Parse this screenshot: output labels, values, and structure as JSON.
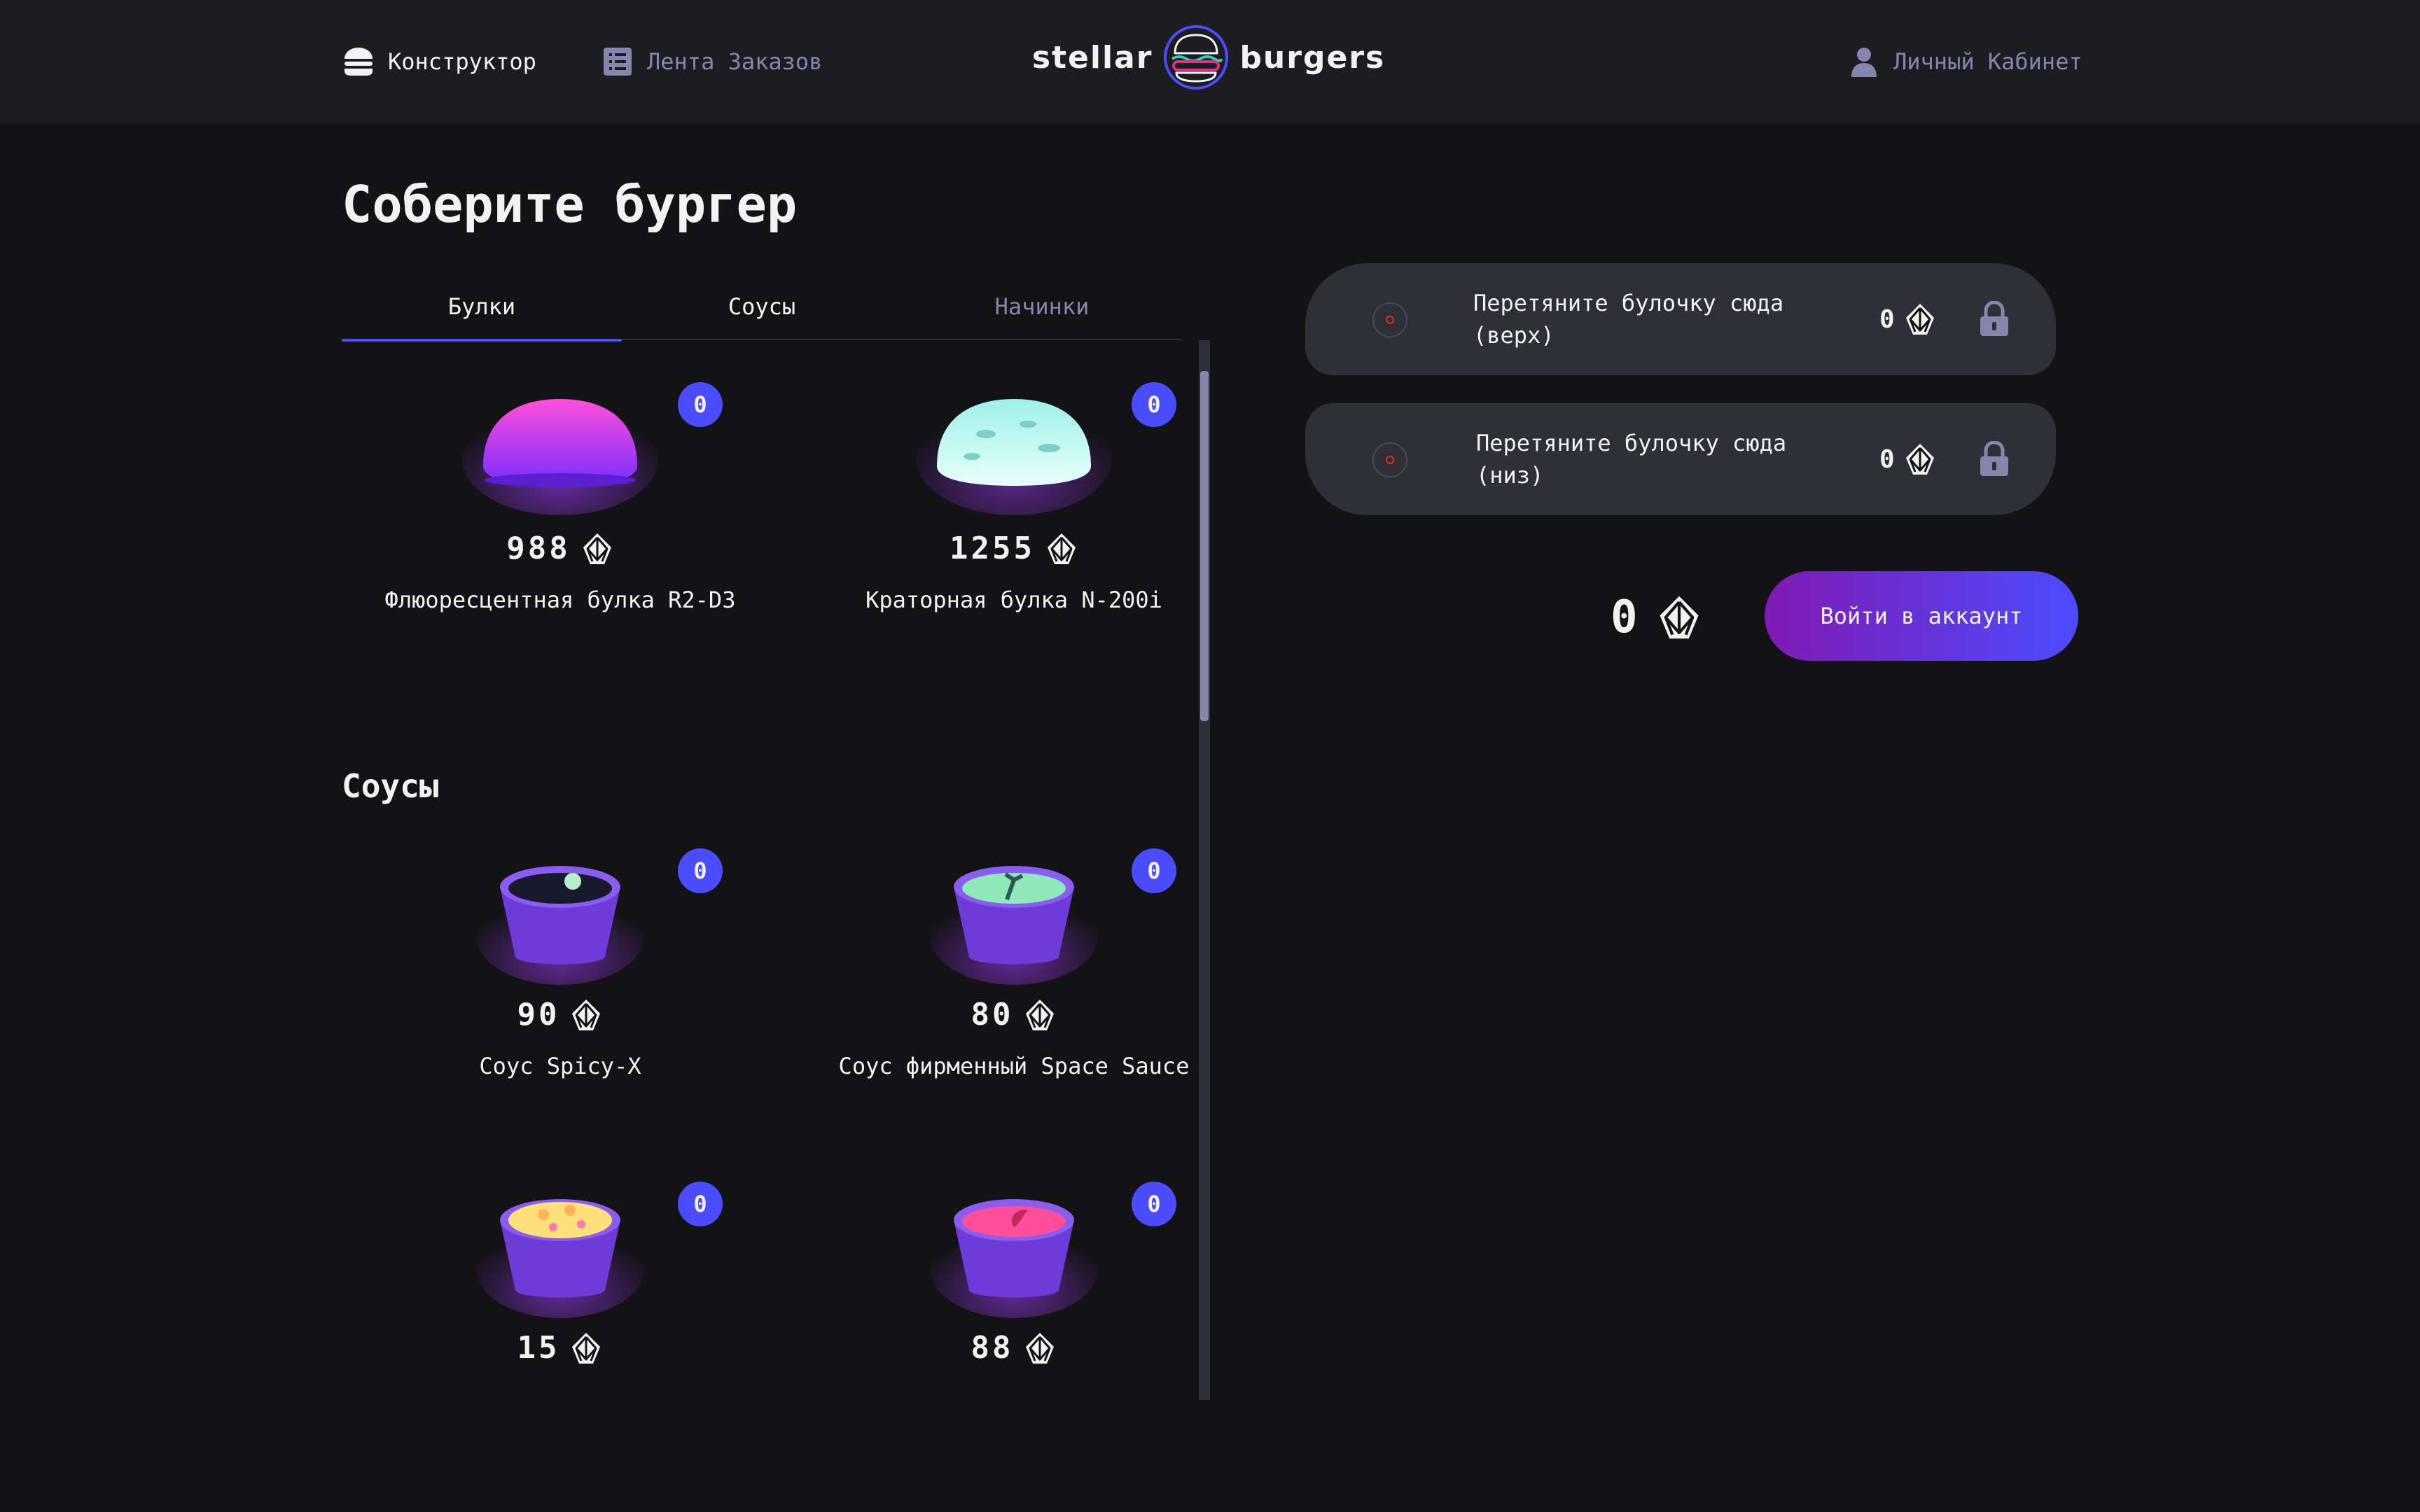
{
  "header": {
    "nav_constructor": "Конструктор",
    "nav_feed": "Лента Заказов",
    "nav_account": "Личный Кабинет",
    "logo_left": "stellar",
    "logo_right": "burgers"
  },
  "main": {
    "title": "Соберите бургер",
    "tabs": [
      {
        "label": "Булки"
      },
      {
        "label": "Соусы"
      },
      {
        "label": "Начинки"
      }
    ],
    "sauces_title": "Соусы",
    "buns": [
      {
        "price": "988",
        "name": "Флюоресцентная булка R2-D3",
        "count": "0"
      },
      {
        "price": "1255",
        "name": "Краторная булка N-200i",
        "count": "0"
      }
    ],
    "sauces": [
      {
        "price": "90",
        "name": "Соус Spicy-X",
        "count": "0"
      },
      {
        "price": "80",
        "name": "Соус фирменный Space Sauce",
        "count": "0"
      },
      {
        "price": "15",
        "name": "",
        "count": "0"
      },
      {
        "price": "88",
        "name": "",
        "count": "0"
      }
    ]
  },
  "constructor": {
    "top_text": "Перетяните булочку сюда (верх)",
    "top_price": "0",
    "bottom_text": "Перетяните булочку сюда (низ)",
    "bottom_price": "0",
    "total": "0",
    "login_label": "Войти в аккаунт"
  },
  "colors": {
    "accent": "#4c4cff",
    "button_gradient_start": "#801ab2",
    "button_gradient_end": "#4c4cff",
    "inactive_text": "#8585ad"
  }
}
